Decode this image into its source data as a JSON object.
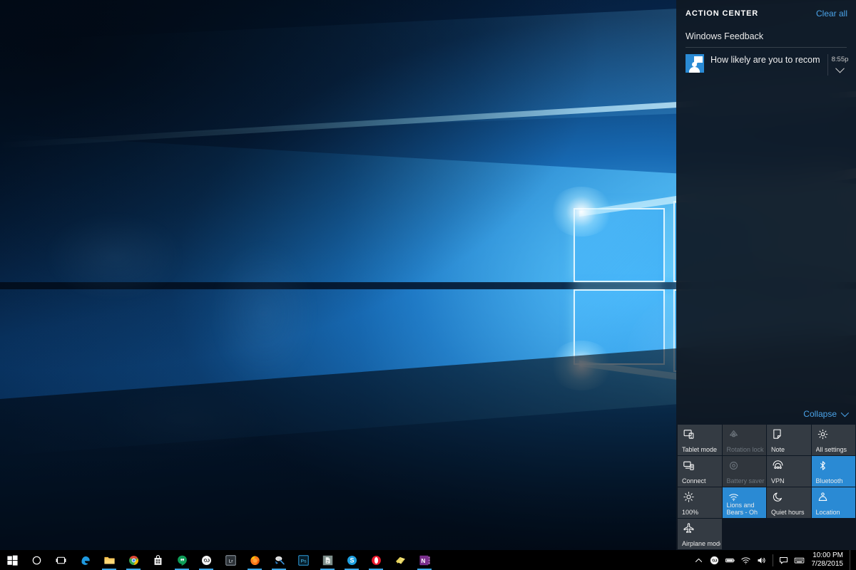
{
  "action_center": {
    "title": "ACTION CENTER",
    "clear_all_label": "Clear all",
    "collapse_label": "Collapse",
    "accent_color": "#2a8ad4",
    "link_color": "#4aa3e8",
    "panel_color": "#0f1822",
    "notification_groups": [
      {
        "app_name": "Windows Feedback",
        "icon": "feedback-person-icon",
        "notifications": [
          {
            "text": "How likely are you to recommend M",
            "time": "8:55p",
            "chevron": "chevron-down-icon"
          }
        ]
      }
    ],
    "quick_actions": [
      {
        "label": "Tablet mode",
        "icon": "tablet-mode-icon",
        "state": "off"
      },
      {
        "label": "Rotation lock",
        "icon": "rotation-lock-icon",
        "state": "disabled"
      },
      {
        "label": "Note",
        "icon": "note-icon",
        "state": "off"
      },
      {
        "label": "All settings",
        "icon": "gear-icon",
        "state": "off"
      },
      {
        "label": "Connect",
        "icon": "connect-icon",
        "state": "off"
      },
      {
        "label": "Battery saver",
        "icon": "battery-saver-icon",
        "state": "disabled"
      },
      {
        "label": "VPN",
        "icon": "vpn-icon",
        "state": "off"
      },
      {
        "label": "Bluetooth",
        "icon": "bluetooth-icon",
        "state": "on"
      },
      {
        "label": "100%",
        "icon": "brightness-icon",
        "state": "off"
      },
      {
        "label": "Lions and Bears - Oh My!",
        "icon": "wifi-icon",
        "state": "on"
      },
      {
        "label": "Quiet hours",
        "icon": "moon-icon",
        "state": "off"
      },
      {
        "label": "Location",
        "icon": "location-icon",
        "state": "on"
      },
      {
        "label": "Airplane mode",
        "icon": "airplane-icon",
        "state": "off"
      }
    ]
  },
  "taskbar": {
    "background_color": "#000000",
    "buttons": [
      {
        "name": "start",
        "icon": "windows-logo-icon",
        "running": false
      },
      {
        "name": "cortana",
        "icon": "cortana-circle-icon",
        "running": false
      },
      {
        "name": "task-view",
        "icon": "task-view-icon",
        "running": false
      },
      {
        "name": "edge",
        "icon": "edge-icon",
        "running": false
      },
      {
        "name": "file-explorer",
        "icon": "folder-icon",
        "running": true
      },
      {
        "name": "chrome",
        "icon": "chrome-icon",
        "running": true
      },
      {
        "name": "store",
        "icon": "store-bag-icon",
        "running": false
      },
      {
        "name": "hangouts",
        "icon": "hangouts-icon",
        "running": true
      },
      {
        "name": "infinity-app",
        "icon": "infinity-icon",
        "running": true
      },
      {
        "name": "lightroom",
        "icon": "lightroom-icon",
        "running": false
      },
      {
        "name": "firefox",
        "icon": "firefox-icon",
        "running": true
      },
      {
        "name": "snagit",
        "icon": "snagit-icon",
        "running": true
      },
      {
        "name": "photoshop",
        "icon": "photoshop-icon",
        "running": false
      },
      {
        "name": "document-app",
        "icon": "document-icon",
        "running": true
      },
      {
        "name": "skype",
        "icon": "skype-icon",
        "running": true
      },
      {
        "name": "opera",
        "icon": "opera-icon",
        "running": true
      },
      {
        "name": "sticky-notes",
        "icon": "sticky-notes-icon",
        "running": false
      },
      {
        "name": "onenote",
        "icon": "onenote-icon",
        "running": true
      }
    ],
    "tray": {
      "icons": [
        {
          "name": "show-hidden-icons",
          "icon": "chevron-up-icon"
        },
        {
          "name": "tray-app",
          "icon": "infinity-icon"
        },
        {
          "name": "battery",
          "icon": "battery-icon"
        },
        {
          "name": "network",
          "icon": "wifi-icon"
        },
        {
          "name": "volume",
          "icon": "speaker-icon"
        },
        {
          "name": "action-center",
          "icon": "action-center-icon"
        },
        {
          "name": "touch-keyboard",
          "icon": "keyboard-icon"
        }
      ],
      "time": "10:00 PM",
      "date": "7/28/2015"
    }
  }
}
